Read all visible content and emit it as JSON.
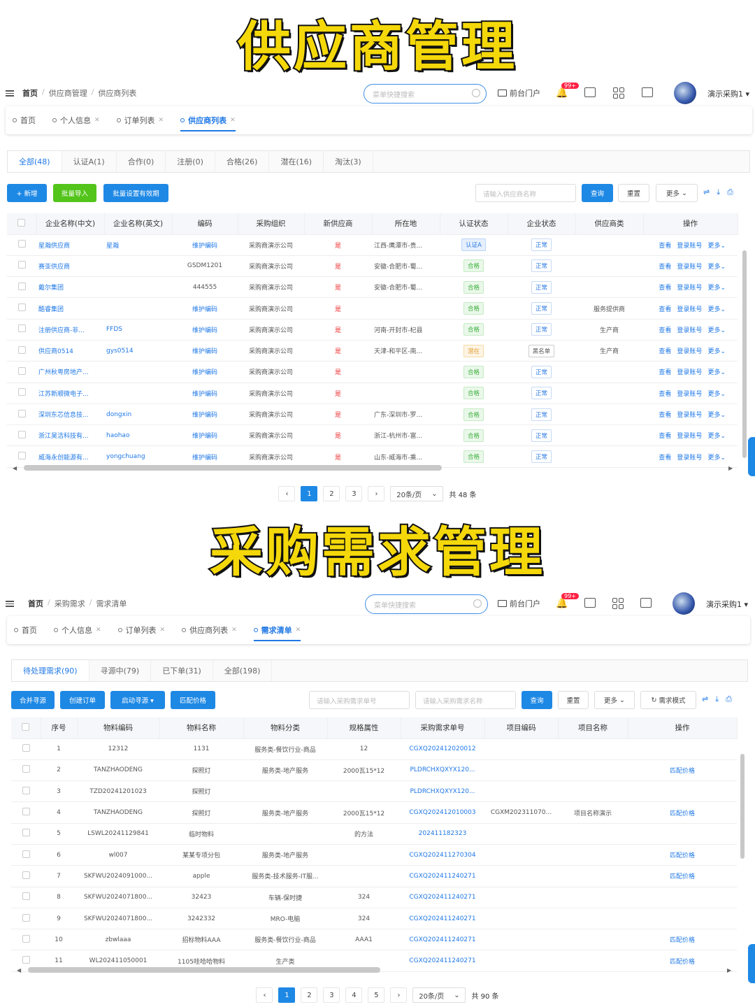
{
  "titles": {
    "top": "供应商管理",
    "bottom": "采购需求管理"
  },
  "header": {
    "search_placeholder": "菜单快捷搜索",
    "frontend_label": "前台门户",
    "notif_badge": "99+",
    "username": "演示采购1 ▾"
  },
  "supplier": {
    "breadcrumb": [
      "首页",
      "供应商管理",
      "供应商列表"
    ],
    "page_tabs": [
      "首页",
      "个人信息",
      "订单列表",
      "供应商列表"
    ],
    "status_tabs": [
      "全部(48)",
      "认证A(1)",
      "合作(0)",
      "注册(0)",
      "合格(26)",
      "潜在(16)",
      "淘汰(3)"
    ],
    "buttons": {
      "add": "+ 新增",
      "import": "批量导入",
      "validity": "批量设置有效期",
      "query": "查询",
      "reset": "重置",
      "more": "更多"
    },
    "search_placeholder": "请输入供应商名称",
    "columns": [
      "企业名称(中文)",
      "企业名称(英文)",
      "编码",
      "采购组织",
      "新供应商",
      "所在地",
      "认证状态",
      "企业状态",
      "供应商类",
      "操作"
    ],
    "ops": [
      "查看",
      "登录账号",
      "更多"
    ],
    "rows": [
      {
        "cn": "星瀚供应商",
        "en": "星瀚",
        "code": "维护编码",
        "org": "采购商演示公司",
        "isnew": "是",
        "loc": "江西-鹰潭市-贵...",
        "auth": "认证A",
        "state": "正常",
        "type": ""
      },
      {
        "cn": "赛亚供应商",
        "en": "",
        "code": "GSDM1201",
        "org": "采购商演示公司",
        "isnew": "是",
        "loc": "安徽-合肥市-蜀...",
        "auth": "合格",
        "state": "正常",
        "type": ""
      },
      {
        "cn": "戴尔集团",
        "en": "",
        "code": "444555",
        "org": "采购商演示公司",
        "isnew": "是",
        "loc": "安徽-合肥市-蜀...",
        "auth": "合格",
        "state": "正常",
        "type": ""
      },
      {
        "cn": "酷睿集团",
        "en": "",
        "code": "维护编码",
        "org": "采购商演示公司",
        "isnew": "是",
        "loc": "",
        "auth": "合格",
        "state": "正常",
        "type": "服务提供商"
      },
      {
        "cn": "注册供应商-非...",
        "en": "FFDS",
        "code": "维护编码",
        "org": "采购商演示公司",
        "isnew": "是",
        "loc": "河南-开封市-杞县",
        "auth": "合格",
        "state": "正常",
        "type": "生产商"
      },
      {
        "cn": "供应商0514",
        "en": "gys0514",
        "code": "维护编码",
        "org": "采购商演示公司",
        "isnew": "是",
        "loc": "天津-和平区-南...",
        "auth": "潜在",
        "state": "黑名单",
        "type": "生产商"
      },
      {
        "cn": "广州秋粤房地产...",
        "en": "",
        "code": "维护编码",
        "org": "采购商演示公司",
        "isnew": "是",
        "loc": "",
        "auth": "合格",
        "state": "正常",
        "type": ""
      },
      {
        "cn": "江苏新顺微电子...",
        "en": "",
        "code": "维护编码",
        "org": "采购商演示公司",
        "isnew": "是",
        "loc": "",
        "auth": "合格",
        "state": "正常",
        "type": ""
      },
      {
        "cn": "深圳东芯信息技...",
        "en": "dongxin",
        "code": "维护编码",
        "org": "采购商演示公司",
        "isnew": "是",
        "loc": "广东-深圳市-罗...",
        "auth": "合格",
        "state": "正常",
        "type": ""
      },
      {
        "cn": "浙江昊洁科技有...",
        "en": "haohao",
        "code": "维护编码",
        "org": "采购商演示公司",
        "isnew": "是",
        "loc": "浙江-杭州市-富...",
        "auth": "合格",
        "state": "正常",
        "type": ""
      },
      {
        "cn": "威海永创能源有...",
        "en": "yongchuang",
        "code": "维护编码",
        "org": "采购商演示公司",
        "isnew": "是",
        "loc": "山东-威海市-乘...",
        "auth": "合格",
        "state": "正常",
        "type": ""
      }
    ],
    "pager": {
      "pages": [
        "1",
        "2",
        "3"
      ],
      "size": "20条/页",
      "total": "共 48 条"
    }
  },
  "demand": {
    "breadcrumb": [
      "首页",
      "采购需求",
      "需求清单"
    ],
    "page_tabs": [
      "首页",
      "个人信息",
      "订单列表",
      "供应商列表",
      "需求清单"
    ],
    "status_tabs": [
      "待处理需求(90)",
      "寻源中(79)",
      "已下单(31)",
      "全部(198)"
    ],
    "buttons": {
      "merge": "合并寻源",
      "order": "创建订单",
      "source": "启动寻源 ▾",
      "match": "匹配价格",
      "query": "查询",
      "reset": "重置",
      "more": "更多",
      "mode": "需求模式"
    },
    "placeholders": {
      "no": "请输入采购需求单号",
      "name": "请输入采购需求名称"
    },
    "columns": [
      "序号",
      "物料编码",
      "物料名称",
      "物料分类",
      "规格属性",
      "采购需求单号",
      "项目编码",
      "项目名称",
      "操作"
    ],
    "rows": [
      {
        "idx": "1",
        "code": "12312",
        "name": "1131",
        "cat": "服务类-餐饮行业-商品",
        "spec": "12",
        "no": "CGXQ202412020012",
        "pcode": "",
        "pname": "",
        "op": ""
      },
      {
        "idx": "2",
        "code": "TANZHAODENG",
        "name": "探照灯",
        "cat": "服务类-地产服务",
        "spec": "2000瓦15*12",
        "no": "PLDRCHXQXYX120...",
        "pcode": "",
        "pname": "",
        "op": "匹配价格"
      },
      {
        "idx": "3",
        "code": "TZD20241201023",
        "name": "探照灯",
        "cat": "",
        "spec": "",
        "no": "PLDRCHXQXYX120...",
        "pcode": "",
        "pname": "",
        "op": ""
      },
      {
        "idx": "4",
        "code": "TANZHAODENG",
        "name": "探照灯",
        "cat": "服务类-地产服务",
        "spec": "2000瓦15*12",
        "no": "CGXQ202412010003",
        "pcode": "CGXM202311070...",
        "pname": "项目名称演示",
        "op": "匹配价格"
      },
      {
        "idx": "5",
        "code": "LSWL20241129841",
        "name": "临时物料",
        "cat": "",
        "spec": "的方法",
        "no": "202411182323",
        "pcode": "",
        "pname": "",
        "op": ""
      },
      {
        "idx": "6",
        "code": "wl007",
        "name": "某某专项分包",
        "cat": "服务类-地产服务",
        "spec": "",
        "no": "CGXQ202411270304",
        "pcode": "",
        "pname": "",
        "op": "匹配价格"
      },
      {
        "idx": "7",
        "code": "SKFWU2024091000...",
        "name": "apple",
        "cat": "服务类-技术服务-IT服...",
        "spec": "",
        "no": "CGXQ202411240271",
        "pcode": "",
        "pname": "",
        "op": "匹配价格"
      },
      {
        "idx": "8",
        "code": "SKFWU2024071800...",
        "name": "32423",
        "cat": "车辆-保时捷",
        "spec": "324",
        "no": "CGXQ202411240271",
        "pcode": "",
        "pname": "",
        "op": ""
      },
      {
        "idx": "9",
        "code": "SKFWU2024071800...",
        "name": "3242332",
        "cat": "MRO-电脑",
        "spec": "324",
        "no": "CGXQ202411240271",
        "pcode": "",
        "pname": "",
        "op": ""
      },
      {
        "idx": "10",
        "code": "zbwlaaa",
        "name": "招标物料AAA",
        "cat": "服务类-餐饮行业-商品",
        "spec": "AAA1",
        "no": "CGXQ202411240271",
        "pcode": "",
        "pname": "",
        "op": "匹配价格"
      },
      {
        "idx": "11",
        "code": "WL202411050001",
        "name": "1105哇哈哈物料",
        "cat": "生产类",
        "spec": "",
        "no": "CGXQ202411240271",
        "pcode": "",
        "pname": "",
        "op": "匹配价格"
      }
    ],
    "pager": {
      "pages": [
        "1",
        "2",
        "3",
        "4",
        "5"
      ],
      "size": "20条/页",
      "total": "共 90 条"
    }
  },
  "colors": {
    "primary": "#1e88e5",
    "green": "#52c41a",
    "title_fill": "#f5d80a"
  }
}
